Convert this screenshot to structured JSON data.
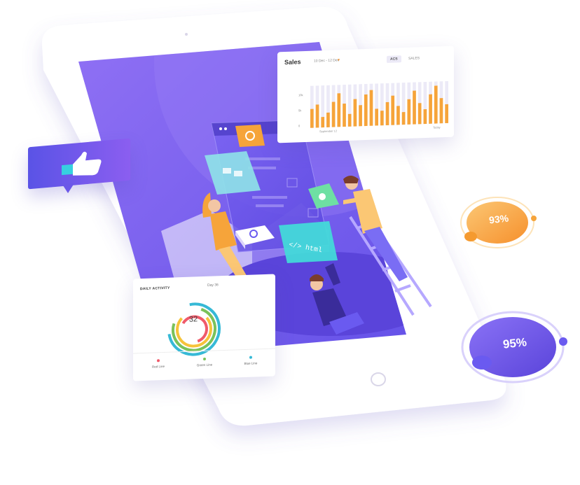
{
  "sales": {
    "title": "Sales",
    "range": "10 Dec - 12 Dec",
    "tab_active": "ACS",
    "tab_other": "SALES",
    "y_ticks": [
      "10k",
      "5k",
      "0"
    ],
    "x_start": "September 12",
    "x_end": "Today",
    "bars": [
      0.45,
      0.55,
      0.25,
      0.35,
      0.6,
      0.8,
      0.55,
      0.3,
      0.65,
      0.5,
      0.75,
      0.85,
      0.4,
      0.35,
      0.55,
      0.7,
      0.45,
      0.3,
      0.6,
      0.8,
      0.5,
      0.35,
      0.7,
      0.9,
      0.6,
      0.45
    ]
  },
  "daily": {
    "title": "DAILY ACTIVITY",
    "day": "Day 36",
    "value": "32",
    "legend": [
      {
        "label": "Red Line",
        "color": "#f05a6a"
      },
      {
        "label": "Green Line",
        "color": "#7ac25a"
      },
      {
        "label": "Blue Line",
        "color": "#36b9d6"
      }
    ]
  },
  "badges": {
    "b93": "93%",
    "b95": "95%"
  },
  "illustration": {
    "code_tag": "</> html"
  },
  "colors": {
    "accent": "#6a5af0",
    "orange": "#f6a43a",
    "device": "#ffffff"
  }
}
